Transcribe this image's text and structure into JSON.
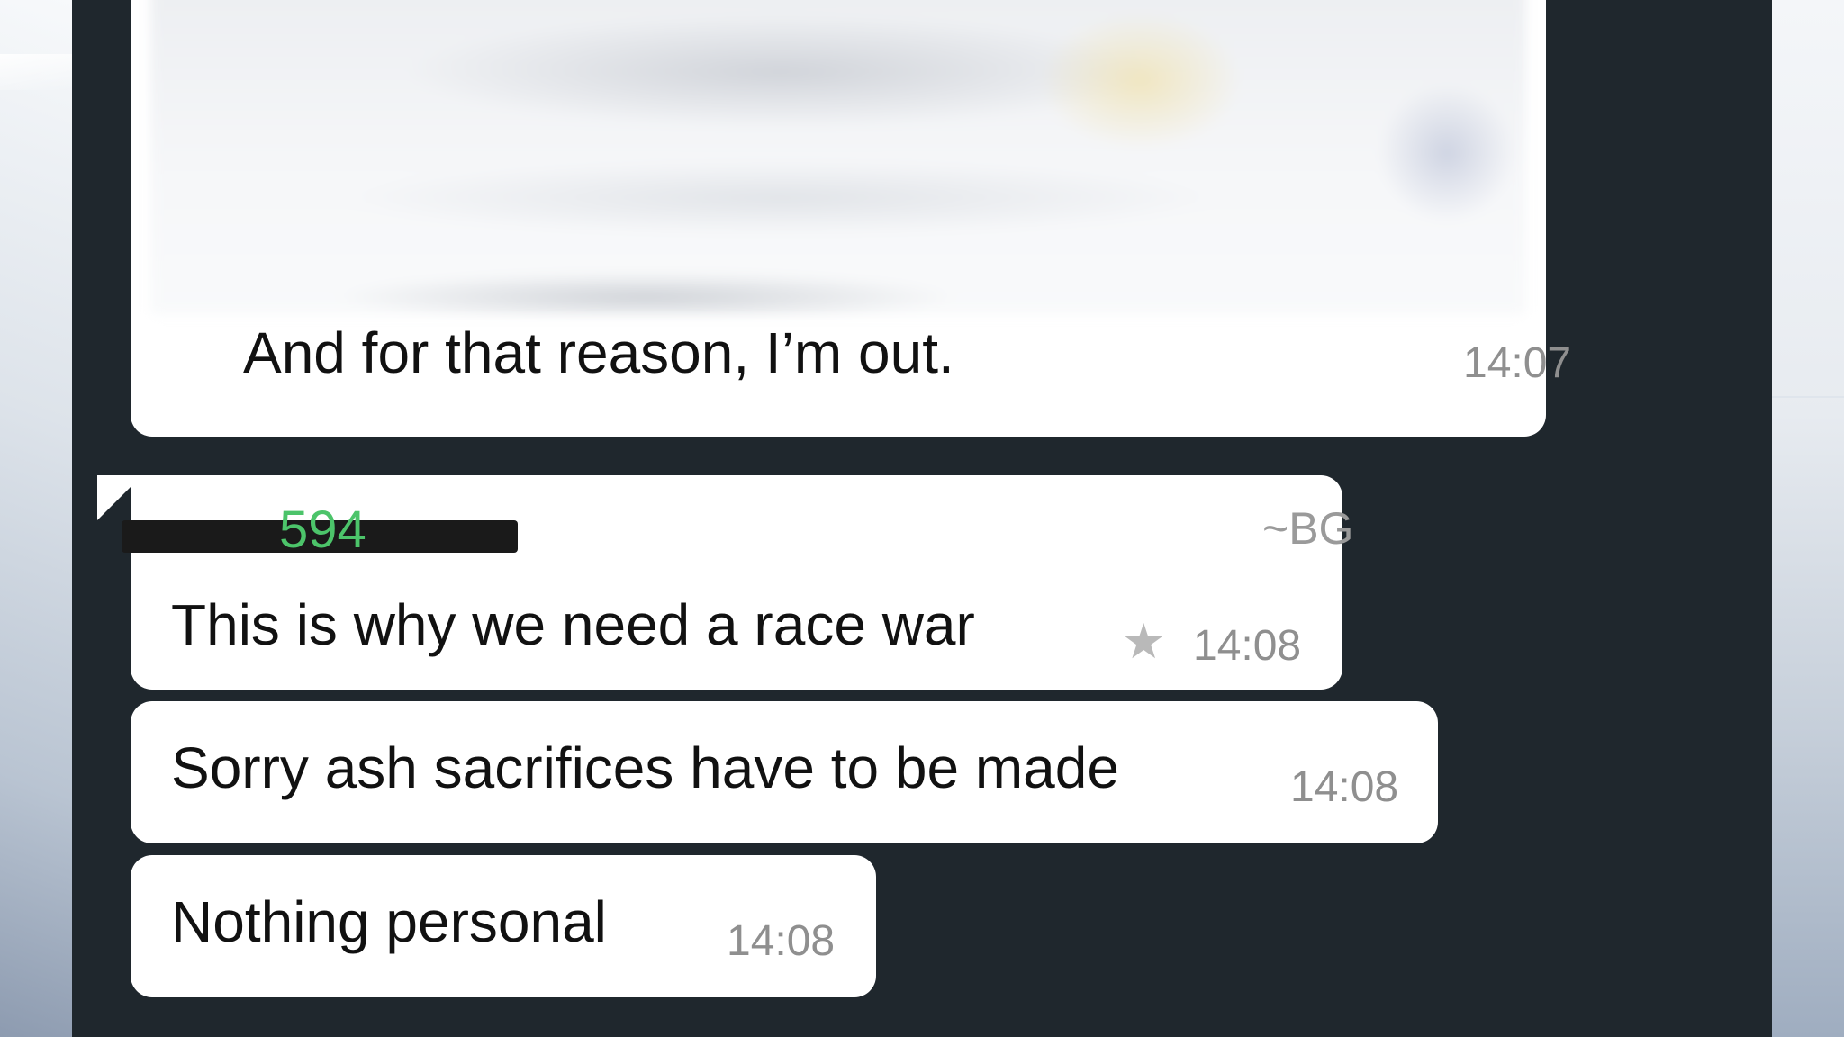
{
  "chat": {
    "messages": [
      {
        "text": "And for that reason, I’m out.",
        "time": "14:07",
        "has_media": true
      },
      {
        "sender_number": "594",
        "sender_name": "~BG",
        "text": "This is why we need a race war",
        "time": "14:08",
        "starred": true,
        "star_icon": "star-icon"
      },
      {
        "text": "Sorry ash sacrifices have to be made",
        "time": "14:08"
      },
      {
        "text": "Nothing personal",
        "time": "14:08"
      }
    ]
  },
  "colors": {
    "chat_background": "#1f272d",
    "bubble": "#ffffff",
    "sender_number": "#4cc46a",
    "timestamp": "#8f8f8f"
  }
}
